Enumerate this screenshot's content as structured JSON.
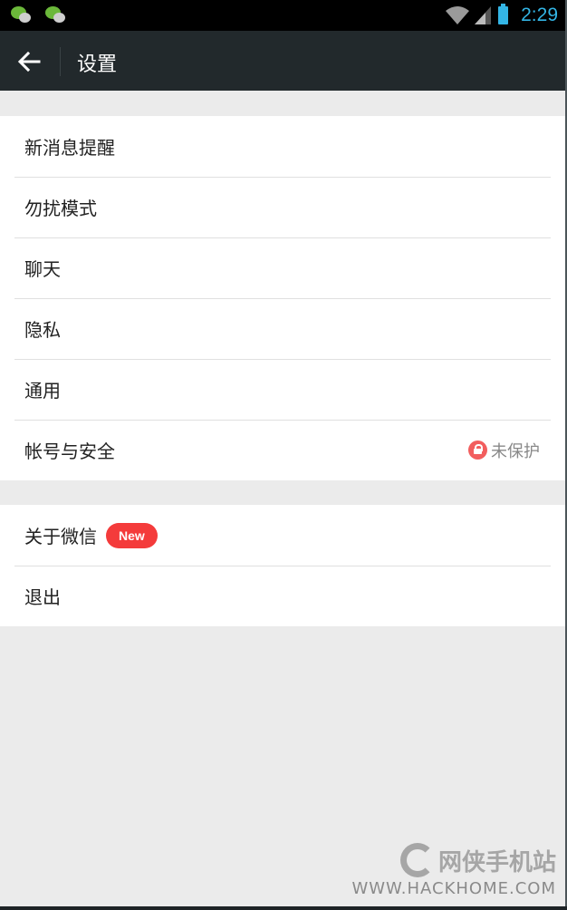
{
  "status_bar": {
    "notification_icons": [
      "wechat-icon",
      "wechat-icon"
    ],
    "system_icons": [
      "wifi-icon",
      "signal-icon",
      "battery-icon"
    ],
    "time": "2:29"
  },
  "action_bar": {
    "back_icon": "arrow-left-icon",
    "title": "设置"
  },
  "settings": {
    "group1": [
      {
        "label": "新消息提醒"
      },
      {
        "label": "勿扰模式"
      },
      {
        "label": "聊天"
      },
      {
        "label": "隐私"
      },
      {
        "label": "通用"
      },
      {
        "label": "帐号与安全",
        "status_icon": "lock-icon",
        "status_text": "未保护"
      }
    ],
    "group2": [
      {
        "label": "关于微信",
        "badge": "New"
      },
      {
        "label": "退出"
      }
    ]
  },
  "colors": {
    "accent": "#33b5e5",
    "badge": "#f43b3b",
    "lock": "#f25e5e",
    "action_bar": "#22292c"
  },
  "watermark": {
    "name": "网侠手机站",
    "url": "WWW.HACKHOME.COM"
  }
}
